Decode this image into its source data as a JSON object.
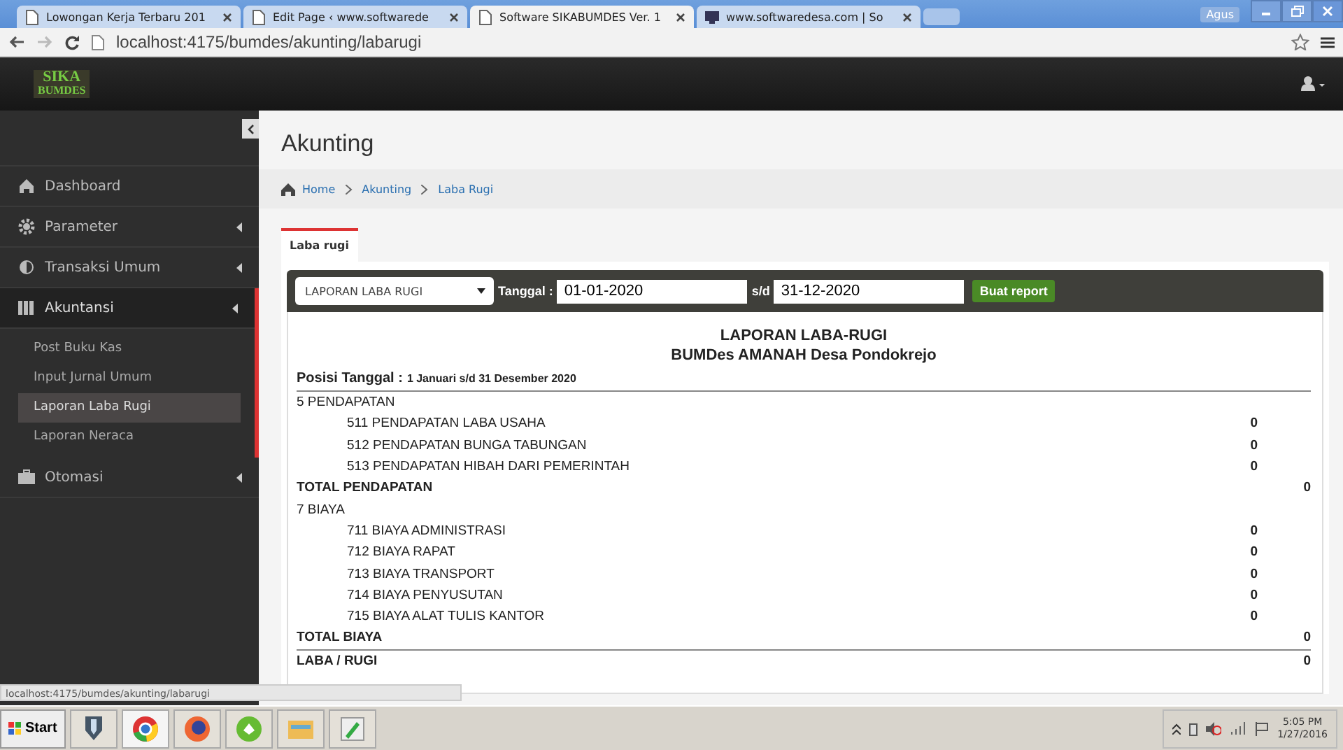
{
  "browser": {
    "tabs": [
      {
        "label": "Lowongan Kerja Terbaru 201",
        "selected": false
      },
      {
        "label": "Edit Page ‹ www.softwarede",
        "selected": false
      },
      {
        "label": "Software SIKABUMDES Ver. 1",
        "selected": true
      },
      {
        "label": "www.softwaredesa.com | So",
        "selected": false
      }
    ],
    "user": "Agus",
    "url": "localhost:4175/bumdes/akunting/labarugi"
  },
  "app": {
    "logo": [
      "SIKA",
      "BUMDES"
    ]
  },
  "sidebar": {
    "items": [
      {
        "label": "Dashboard",
        "kind": "link"
      },
      {
        "label": "Parameter",
        "kind": "menu",
        "expanded": false
      },
      {
        "label": "Transaksi Umum",
        "kind": "menu",
        "expanded": false
      },
      {
        "label": "Akuntansi",
        "kind": "menu",
        "expanded": true,
        "children": [
          {
            "label": "Post Buku Kas",
            "selected": false
          },
          {
            "label": "Input Jurnal Umum",
            "selected": false
          },
          {
            "label": "Laporan Laba Rugi",
            "selected": true
          },
          {
            "label": "Laporan Neraca",
            "selected": false
          }
        ]
      },
      {
        "label": "Otomasi",
        "kind": "menu",
        "expanded": false
      }
    ]
  },
  "page": {
    "title": "Akunting",
    "breadcrumb": [
      "Home",
      "Akunting",
      "Laba Rugi"
    ],
    "tabs": [
      {
        "label": "Laba rugi",
        "selected": true
      }
    ],
    "toolbar": {
      "report_select": "LAPORAN LABA RUGI",
      "date_label": "Tanggal :",
      "date_from": "01-01-2020",
      "range_label": "s/d",
      "date_to": "31-12-2020",
      "button": "Buat report"
    },
    "report": {
      "title": "LAPORAN LABA-RUGI",
      "subtitle": "BUMDes AMANAH Desa Pondokrejo",
      "position_label": "Posisi Tanggal :",
      "position_value": "1 Januari s/d 31 Desember 2020",
      "lines": [
        {
          "kind": "group",
          "label": "5 PENDAPATAN"
        },
        {
          "kind": "item",
          "label": "511 PENDAPATAN LABA USAHA",
          "value": "0"
        },
        {
          "kind": "item",
          "label": "512 PENDAPATAN BUNGA TABUNGAN",
          "value": "0"
        },
        {
          "kind": "item",
          "label": "513 PENDAPATAN HIBAH DARI PEMERINTAH",
          "value": "0"
        },
        {
          "kind": "total",
          "label": "TOTAL PENDAPATAN",
          "value": "0"
        },
        {
          "kind": "group",
          "label": "7 BIAYA"
        },
        {
          "kind": "item",
          "label": "711 BIAYA ADMINISTRASI",
          "value": "0"
        },
        {
          "kind": "item",
          "label": "712 BIAYA RAPAT",
          "value": "0"
        },
        {
          "kind": "item",
          "label": "713 BIAYA TRANSPORT",
          "value": "0"
        },
        {
          "kind": "item",
          "label": "714 BIAYA PENYUSUTAN",
          "value": "0"
        },
        {
          "kind": "item",
          "label": "715 BIAYA ALAT TULIS KANTOR",
          "value": "0"
        },
        {
          "kind": "total",
          "label": "TOTAL BIAYA",
          "value": "0"
        },
        {
          "kind": "result",
          "label": "LABA / RUGI",
          "value": "0"
        }
      ]
    }
  },
  "status_bar": {
    "url": "localhost:4175/bumdes/akunting/labarugi"
  },
  "taskbar": {
    "start": "Start",
    "time": "5:05 PM",
    "date": "1/27/2016"
  }
}
